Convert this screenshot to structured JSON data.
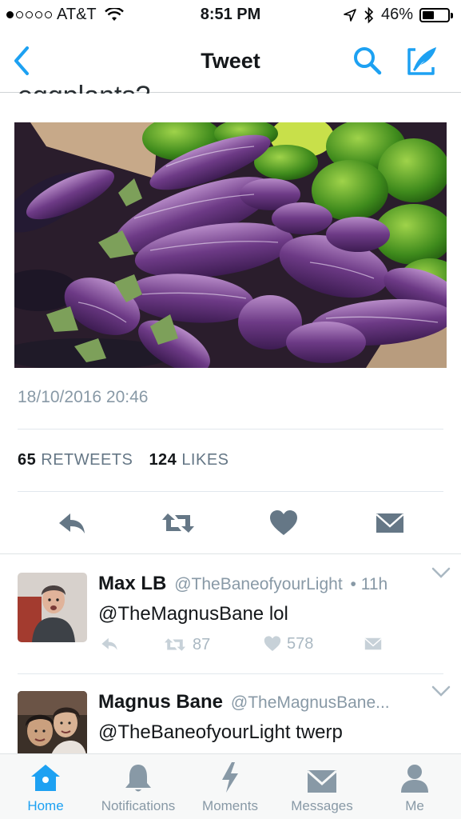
{
  "status_bar": {
    "carrier": "AT&T",
    "time": "8:51 PM",
    "battery": "46%",
    "battery_level": 0.46,
    "signal_dots_filled": 1
  },
  "nav": {
    "title": "Tweet",
    "icons": [
      "back-chevron-icon",
      "search-icon",
      "compose-icon"
    ]
  },
  "tweet": {
    "text_partial": "eggplants?",
    "photo_alt": "",
    "timestamp": "18/10/2016 20:46",
    "retweet_count": "65",
    "retweet_label": "RETWEETS",
    "like_count": "124",
    "like_label": "LIKES"
  },
  "replies": [
    {
      "name": "Max LB",
      "handle": "@TheBaneofyourLight",
      "separator": "•",
      "time": "11h",
      "text": "@TheMagnusBane lol",
      "retweets": "87",
      "likes": "578"
    },
    {
      "name": "Magnus Bane",
      "handle": "@TheMagnusBane...",
      "text": "@TheBaneofyourLight twerp"
    }
  ],
  "tab_bar": {
    "items": [
      {
        "label": "Home",
        "icon": "home-icon",
        "active": true
      },
      {
        "label": "Notifications",
        "icon": "bell-icon",
        "active": false
      },
      {
        "label": "Moments",
        "icon": "lightning-icon",
        "active": false
      },
      {
        "label": "Messages",
        "icon": "envelope-icon",
        "active": false
      },
      {
        "label": "Me",
        "icon": "person-icon",
        "active": false
      }
    ]
  },
  "colors": {
    "accent": "#1da1f2",
    "icon_gray": "#657786",
    "muted": "#8899a6"
  }
}
